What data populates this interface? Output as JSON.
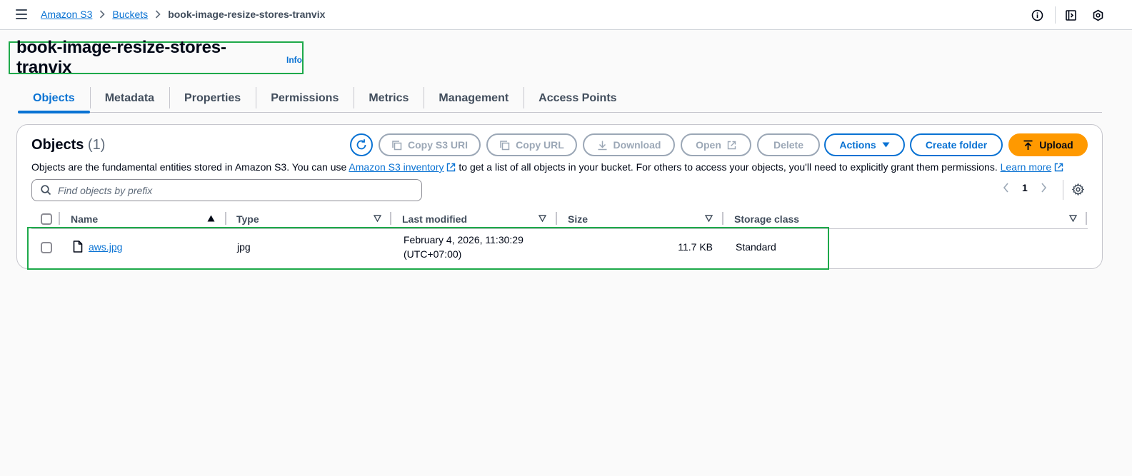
{
  "breadcrumb": {
    "items": [
      "Amazon S3",
      "Buckets"
    ],
    "current": "book-image-resize-stores-tranvix"
  },
  "header": {
    "title": "book-image-resize-stores-tranvix",
    "info": "Info"
  },
  "tabs": [
    "Objects",
    "Metadata",
    "Properties",
    "Permissions",
    "Metrics",
    "Management",
    "Access Points"
  ],
  "objects_panel": {
    "title": "Objects",
    "count": "(1)",
    "desc_before": "Objects are the fundamental entities stored in Amazon S3. You can use",
    "desc_link": "Amazon S3 inventory",
    "desc_after": "to get a list of all objects in your bucket. For others to access your objects, you'll need to explicitly grant them permissions.",
    "learn_more": "Learn more",
    "buttons": {
      "copy_s3_uri": "Copy S3 URI",
      "copy_url": "Copy URL",
      "download": "Download",
      "open": "Open",
      "delete": "Delete",
      "actions": "Actions",
      "create_folder": "Create folder",
      "upload": "Upload"
    },
    "search_placeholder": "Find objects by prefix",
    "page_number": "1"
  },
  "table": {
    "columns": [
      "Name",
      "Type",
      "Last modified",
      "Size",
      "Storage class"
    ],
    "rows": [
      {
        "name": "aws.jpg",
        "type": "jpg",
        "last_modified_line1": "February 4, 2026, 11:30:29",
        "last_modified_line2": "(UTC+07:00)",
        "size": "11.7 KB",
        "storage_class": "Standard"
      }
    ]
  },
  "colors": {
    "link": "#0972d3",
    "upload": "#ff9900",
    "highlight": "#1ea94a",
    "disabled": "#9ba7b6"
  },
  "icons": [
    "menu-icon",
    "chevron-right-icon",
    "info-icon",
    "panel-icon",
    "hexagon-icon",
    "refresh-icon",
    "copy-icon",
    "download-icon",
    "external-link-icon",
    "caret-down-icon",
    "upload-icon",
    "search-icon",
    "chevron-left-icon",
    "settings-icon",
    "sort-ascending-icon",
    "sort-icon",
    "file-icon"
  ]
}
